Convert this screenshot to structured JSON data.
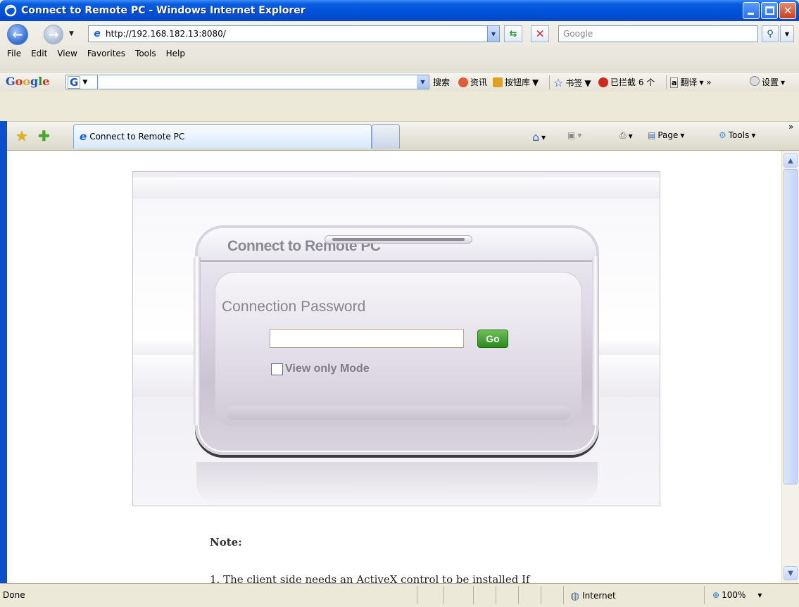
{
  "window": {
    "title": "Connect to Remote PC - Windows Internet Explorer"
  },
  "address_bar": {
    "url": "http://192.168.182.13:8080/",
    "search_placeholder": "Google"
  },
  "menu": [
    "File",
    "Edit",
    "View",
    "Favorites",
    "Tools",
    "Help"
  ],
  "google_toolbar": {
    "logo": "Google",
    "items": {
      "search": "搜索",
      "news": "资讯",
      "buttons": "按钮库",
      "bookmarks": "书签",
      "blocked": "已拦截 6 个",
      "translate": "翻译",
      "settings": "设置"
    }
  },
  "tabs": {
    "active_label": "Connect to Remote PC"
  },
  "command_bar": {
    "page": "Page",
    "tools": "Tools"
  },
  "page": {
    "dialog_title": "Connect to Remote PC",
    "password_label": "Connection Password",
    "go_label": "Go",
    "view_only_label": "View only Mode",
    "note_heading": "Note:",
    "note_line_1": "1. The client side needs an ActiveX control to be installed If"
  },
  "status_bar": {
    "status": "Done",
    "zone": "Internet",
    "zoom": "100%"
  },
  "icons": [
    "ie-logo-icon",
    "back-icon",
    "forward-icon",
    "refresh-icon",
    "stop-icon",
    "search-icon",
    "favorites-star-icon",
    "add-favorites-icon",
    "home-icon",
    "feeds-icon",
    "print-icon",
    "page-icon",
    "tools-gear-icon",
    "globe-icon",
    "zoom-icon"
  ]
}
